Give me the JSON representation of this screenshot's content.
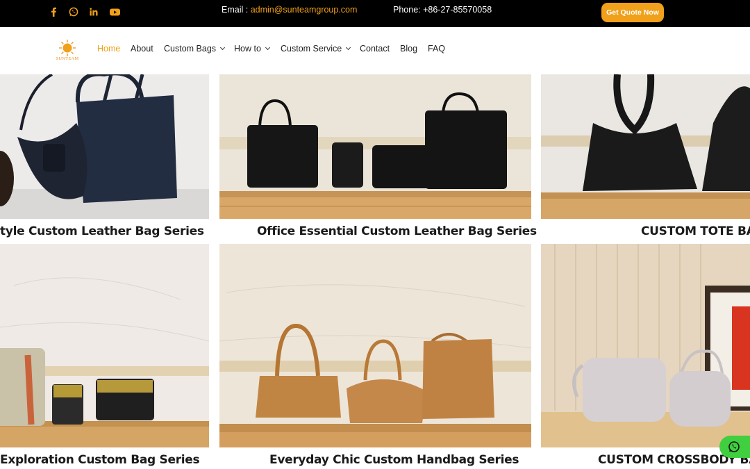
{
  "topbar": {
    "social_icons": [
      "facebook-icon",
      "whatsapp-icon",
      "linkedin-icon",
      "youtube-icon"
    ],
    "email_label": "Email :",
    "email_value": "admin@sunteamgroup.com",
    "phone_label": "Phone:",
    "phone_value": "+86-27-85570058",
    "quote_button": "Get Quote Now"
  },
  "nav": {
    "logo_text": "SUNTEAM",
    "items": [
      {
        "label": "Home",
        "active": true
      },
      {
        "label": "About"
      },
      {
        "label": "Custom Bags",
        "dropdown": true
      },
      {
        "label": "How to",
        "dropdown": true
      },
      {
        "label": "Custom Service",
        "dropdown": true
      },
      {
        "label": "Contact"
      },
      {
        "label": "Blog"
      },
      {
        "label": "FAQ"
      }
    ]
  },
  "gallery": [
    {
      "caption": "tyle Custom Leather Bag Series"
    },
    {
      "caption": "Office Essential Custom Leather Bag Series"
    },
    {
      "caption": "CUSTOM TOTE BAG"
    },
    {
      "caption": "Exploration Custom Bag Series"
    },
    {
      "caption": "Everyday Chic Custom Handbag Series"
    },
    {
      "caption": "CUSTOM CROSSBODY BAG"
    }
  ],
  "colors": {
    "accent": "#f0a01a",
    "topbar_bg": "#000000",
    "whatsapp": "#3fcf3f"
  },
  "floating": {
    "icon": "whatsapp-icon"
  }
}
